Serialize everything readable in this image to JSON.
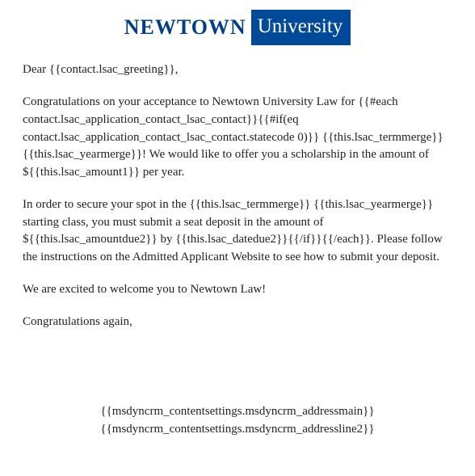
{
  "logo": {
    "left": "NEWTOWN",
    "right": "University"
  },
  "greeting": "Dear {{contact.lsac_greeting}},",
  "paragraph1": "Congratulations on your acceptance to Newtown University Law for {{#each contact.lsac_application_contact_lsac_contact}}{{#if(eq contact.lsac_application_contact_lsac_contact.statecode 0)}} {{this.lsac_termmerge}} {{this.lsac_yearmerge}}! We would like to offer you a scholarship in the amount of ${{this.lsac_amount1}} per year.",
  "paragraph2": "In order to secure your spot in the {{this.lsac_termmerge}} {{this.lsac_yearmerge}} starting class, you must submit a seat deposit in the amount of ${{this.lsac_amountdue2}} by {{this.lsac_datedue2}}{{/if}}{{/each}}. Please follow the instructions on the Admitted Applicant Website to see how to submit your deposit.",
  "signoff1": "We are excited to welcome you to Newtown Law!",
  "signoff2": "Congratulations again,",
  "footer": {
    "line1": "{{msdyncrm_contentsettings.msdyncrm_addressmain}}",
    "line2": "{{msdyncrm_contentsettings.msdyncrm_addressline2}}"
  }
}
